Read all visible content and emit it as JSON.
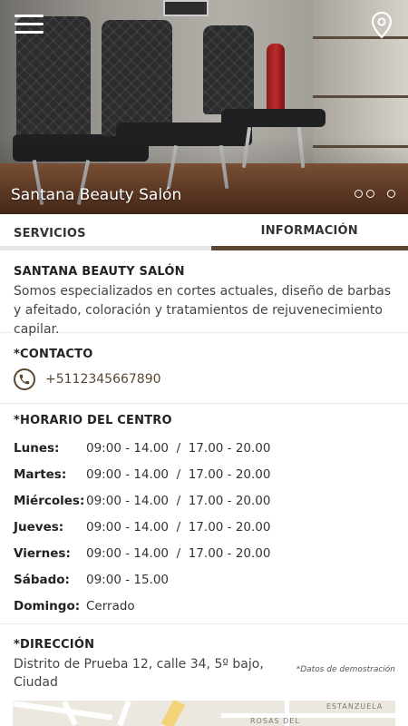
{
  "hero": {
    "title": "Santana Beauty Salón",
    "slide_count": 3,
    "active_slide": 1,
    "icons": {
      "menu": "hamburger-menu-icon",
      "location": "location-pin-icon"
    }
  },
  "tabs": [
    {
      "label": "SERVICIOS",
      "active": false
    },
    {
      "label": "INFORMACIÓN",
      "active": true
    }
  ],
  "about": {
    "title": "SANTANA BEAUTY SALÓN",
    "description": "Somos especializados en cortes actuales, diseño de barbas y afeitado, coloración y tratamientos de rejuvenecimiento capilar."
  },
  "contact": {
    "title": "*CONTACTO",
    "phone": "+5112345667890",
    "icon": "phone-icon"
  },
  "schedule": {
    "title": "*HORARIO DEL CENTRO",
    "rows": [
      {
        "day": "Lunes:",
        "hours": "09:00 - 14.00  /  17.00 - 20.00"
      },
      {
        "day": "Martes:",
        "hours": "09:00 - 14.00  /  17.00 - 20.00"
      },
      {
        "day": "Miércoles:",
        "hours": "09:00 - 14.00  /  17.00 - 20.00"
      },
      {
        "day": "Jueves:",
        "hours": "09:00 - 14.00  /  17.00 - 20.00"
      },
      {
        "day": "Viernes:",
        "hours": "09:00 - 14.00  /  17.00 - 20.00"
      },
      {
        "day": "Sábado:",
        "hours": "09:00 - 15.00"
      },
      {
        "day": "Domingo:",
        "hours": "Cerrado"
      }
    ]
  },
  "address": {
    "title": "*DIRECCIÓN",
    "line": "Distrito de Prueba 12, calle 34, 5º bajo, Ciudad",
    "demo_note": "*Datos de demostración"
  },
  "map": {
    "labels": [
      "ESTANZUELA",
      "ROSAS DEL"
    ]
  },
  "colors": {
    "accent": "#5b4632",
    "tab_inactive": "#e6e6e6"
  }
}
